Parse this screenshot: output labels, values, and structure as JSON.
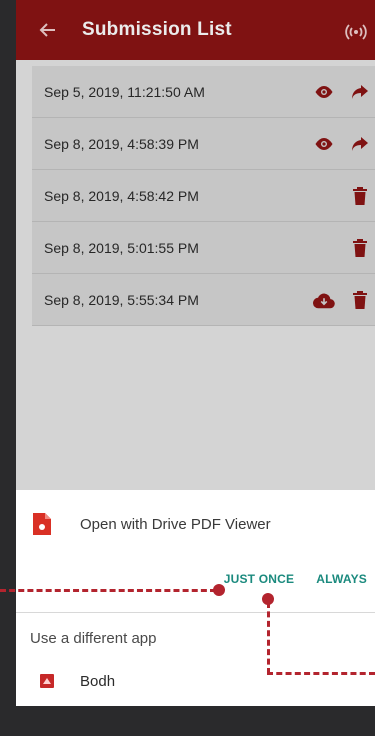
{
  "appbar": {
    "title": "Submission List",
    "back_icon": "arrow-left-icon",
    "right_icon": "wifi-tethering-icon",
    "color": "#8a1414"
  },
  "submissions": [
    {
      "timestamp": "Sep 5, 2019, 11:21:50 AM",
      "actions": [
        "eye-icon",
        "share-arrow-icon"
      ]
    },
    {
      "timestamp": "Sep 8, 2019, 4:58:39 PM",
      "actions": [
        "eye-icon",
        "share-arrow-icon"
      ]
    },
    {
      "timestamp": "Sep 8, 2019, 4:58:42 PM",
      "actions": [
        "trash-icon"
      ]
    },
    {
      "timestamp": "Sep 8, 2019, 5:01:55 PM",
      "actions": [
        "trash-icon"
      ]
    },
    {
      "timestamp": "Sep 8, 2019, 5:55:34 PM",
      "actions": [
        "cloud-download-icon",
        "trash-icon"
      ]
    }
  ],
  "chooser": {
    "open_with": "Open with Drive PDF Viewer",
    "just_once": "JUST ONCE",
    "always": "ALWAYS",
    "use_different": "Use a different app",
    "alt_app": "Bodh",
    "button_color": "#1b8a7e"
  },
  "annotation_color": "#b3242e"
}
